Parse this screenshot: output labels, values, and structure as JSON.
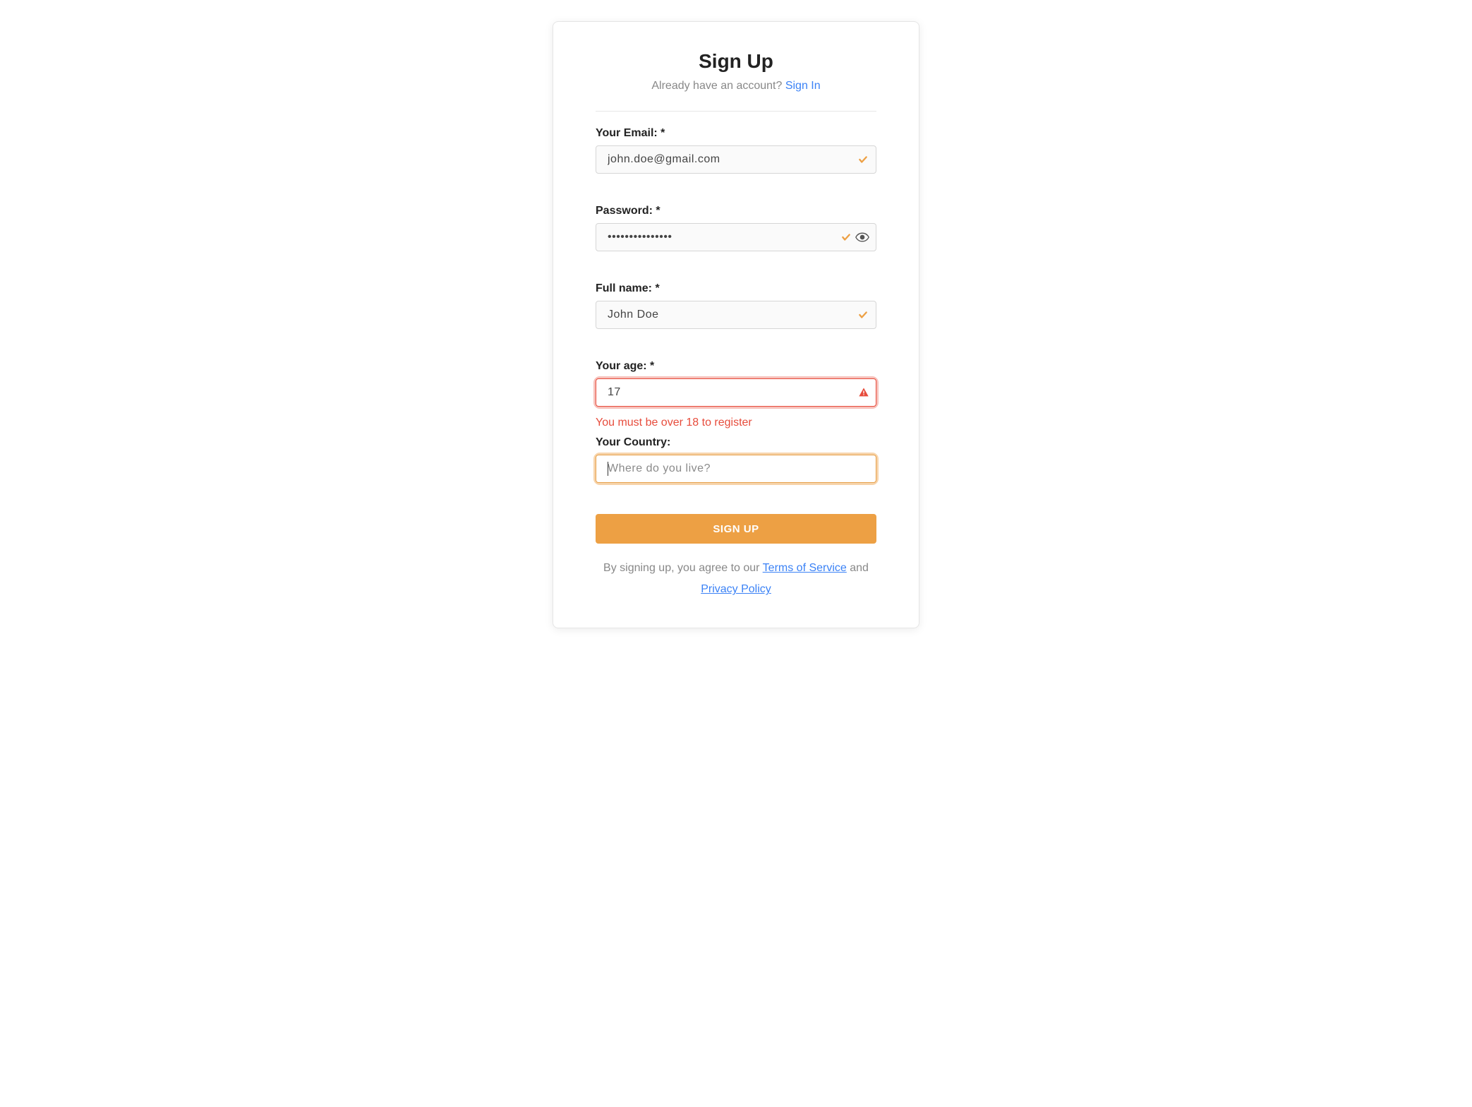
{
  "header": {
    "title": "Sign Up",
    "haveAccount": "Already have an account? ",
    "signIn": "Sign In"
  },
  "fields": {
    "email": {
      "label": "Your Email: *",
      "value": "john.doe@gmail.com"
    },
    "password": {
      "label": "Password: *",
      "value": "•••••••••••••••"
    },
    "name": {
      "label": "Full name: *",
      "value": "John Doe"
    },
    "age": {
      "label": "Your age: *",
      "value": "17",
      "error": "You must be over 18 to register"
    },
    "country": {
      "label": "Your Country:",
      "placeholder": "Where do you live?"
    }
  },
  "submit": "SIGN UP",
  "legal": {
    "prefix": "By signing up, you agree to our ",
    "tos": "Terms of Service",
    "and": " and ",
    "privacy": "Privacy Policy"
  },
  "colors": {
    "accent": "#eda044",
    "error": "#e74c3c",
    "link": "#3b82f6"
  }
}
